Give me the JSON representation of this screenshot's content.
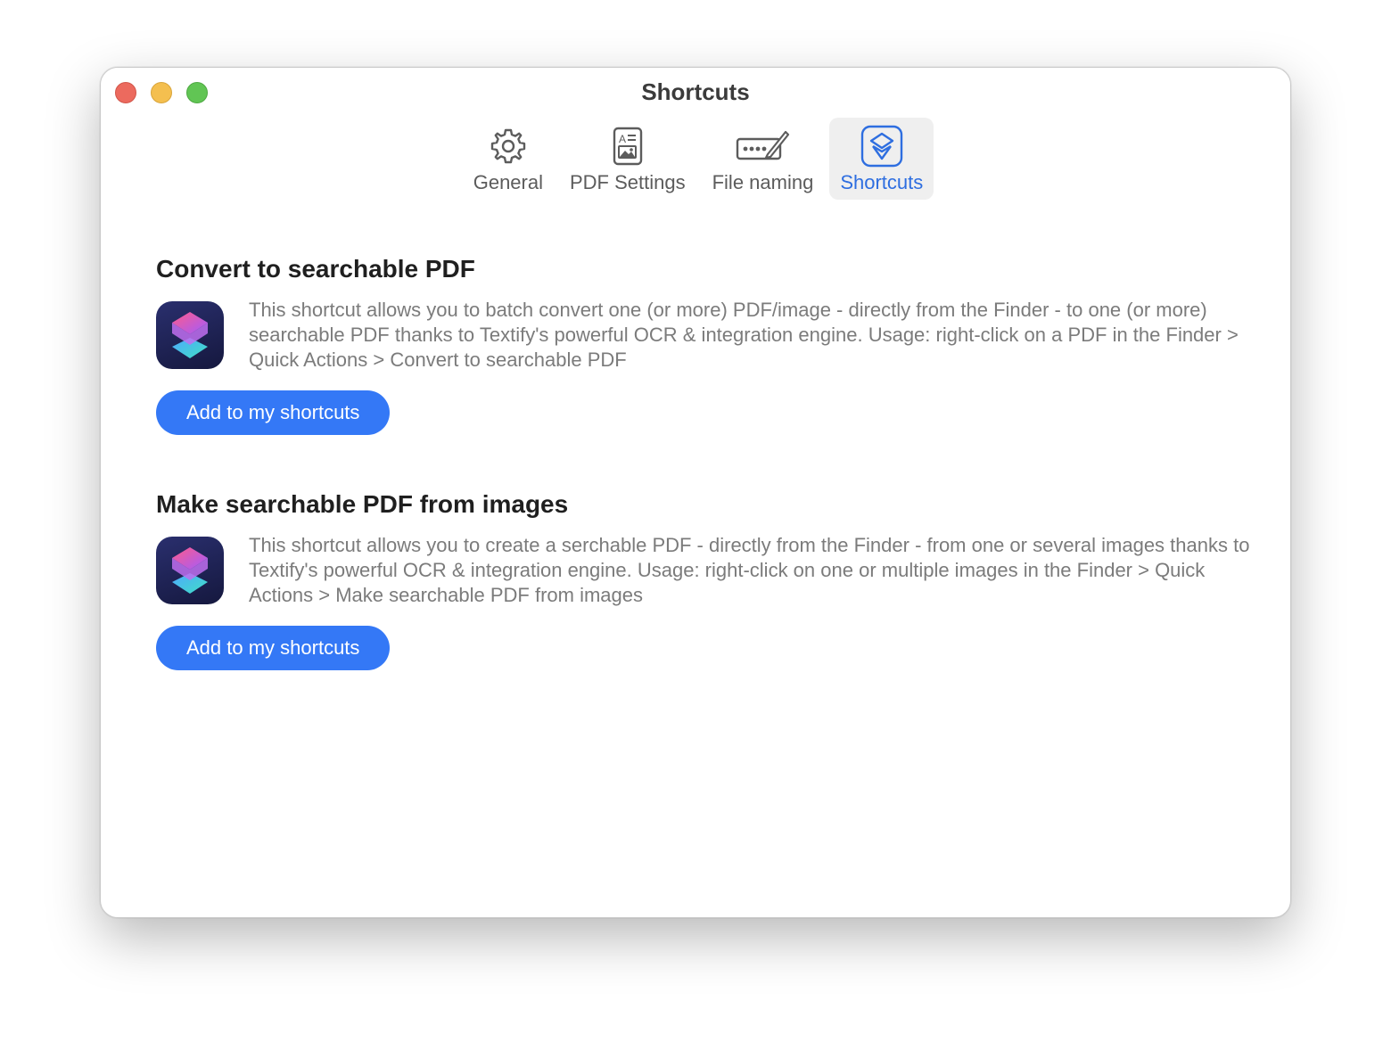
{
  "window": {
    "title": "Shortcuts"
  },
  "toolbar": {
    "tabs": [
      {
        "label": "General",
        "icon": "gear-icon"
      },
      {
        "label": "PDF Settings",
        "icon": "document-icon"
      },
      {
        "label": "File naming",
        "icon": "rename-icon"
      },
      {
        "label": "Shortcuts",
        "icon": "shortcuts-icon",
        "selected": true
      }
    ]
  },
  "sections": [
    {
      "title": "Convert to searchable PDF",
      "description": "This shortcut allows you to batch convert one (or more) PDF/image - directly from the Finder - to one (or more) searchable PDF thanks to Textify's powerful OCR & integration engine. Usage: right-click on a PDF in the Finder > Quick Actions > Convert to searchable PDF",
      "button_label": "Add to my shortcuts"
    },
    {
      "title": "Make searchable PDF from images",
      "description": "This shortcut allows you to create a serchable PDF - directly from the Finder - from one or several images thanks to Textify's powerful OCR & integration engine. Usage: right-click on one or multiple images in the Finder > Quick Actions > Make searchable PDF from images",
      "button_label": "Add to my shortcuts"
    }
  ],
  "colors": {
    "accent": "#3478f6",
    "selected_tab_text": "#2e6ee0",
    "close": "#ec6a5e",
    "minimize": "#f4bf4f",
    "maximize": "#61c554"
  }
}
